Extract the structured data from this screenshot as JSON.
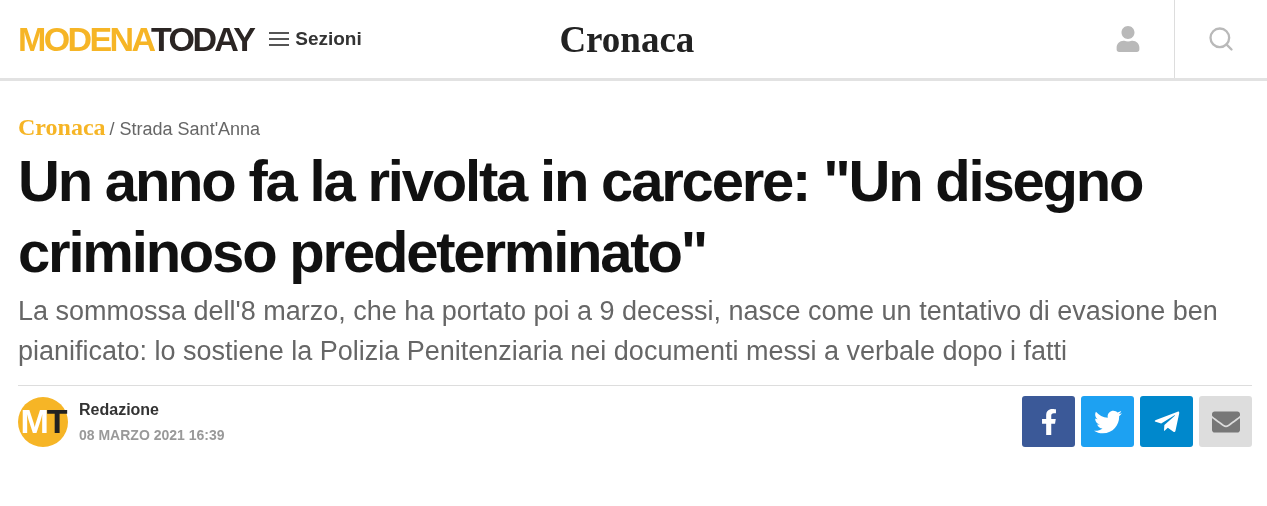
{
  "header": {
    "logo": [
      "MODENA",
      "TODAY"
    ],
    "menu_label": "Sezioni",
    "section_title": "Cronaca"
  },
  "breadcrumb": {
    "section": "Cronaca",
    "place": "/ Strada Sant'Anna"
  },
  "article": {
    "headline": "Un anno fa la rivolta in carcere: \"Un disegno criminoso predeterminato\"",
    "summary": "La sommossa dell'8 marzo, che ha portato poi a 9 decessi, nasce come un tentativo di evasione ben pianificato: lo sostiene la Polizia Penitenziaria nei documenti messi a verbale dopo i fatti"
  },
  "author": {
    "initials": [
      "M",
      "T"
    ],
    "name": "Redazione",
    "date": "08 MARZO 2021 16:39"
  },
  "share_buttons": [
    {
      "kind": "facebook"
    },
    {
      "kind": "twitter"
    },
    {
      "kind": "telegram"
    },
    {
      "kind": "email"
    }
  ]
}
